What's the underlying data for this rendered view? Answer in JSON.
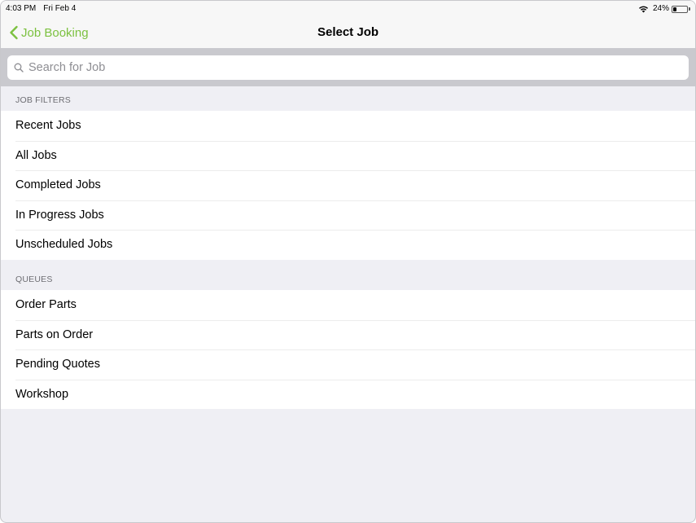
{
  "status_bar": {
    "time": "4:03 PM",
    "date": "Fri Feb 4",
    "battery_percent": "24%",
    "battery_level": 0.24,
    "wifi_icon": "wifi-icon",
    "battery_icon": "battery-icon"
  },
  "nav": {
    "back_label": "Job Booking",
    "back_icon": "chevron-left-icon",
    "title": "Select Job"
  },
  "search": {
    "placeholder": "Search for Job",
    "value": "",
    "icon": "search-icon"
  },
  "sections": [
    {
      "header": "JOB FILTERS",
      "items": [
        "Recent Jobs",
        "All Jobs",
        "Completed Jobs",
        "In Progress Jobs",
        "Unscheduled Jobs"
      ]
    },
    {
      "header": "QUEUES",
      "items": [
        "Order Parts",
        "Parts on Order",
        "Pending Quotes",
        "Workshop"
      ]
    }
  ],
  "colors": {
    "accent": "#7cc140",
    "background": "#efeff4",
    "search_bar": "#c9c9ce",
    "cell": "#ffffff",
    "section_header_text": "#6d6d72"
  }
}
